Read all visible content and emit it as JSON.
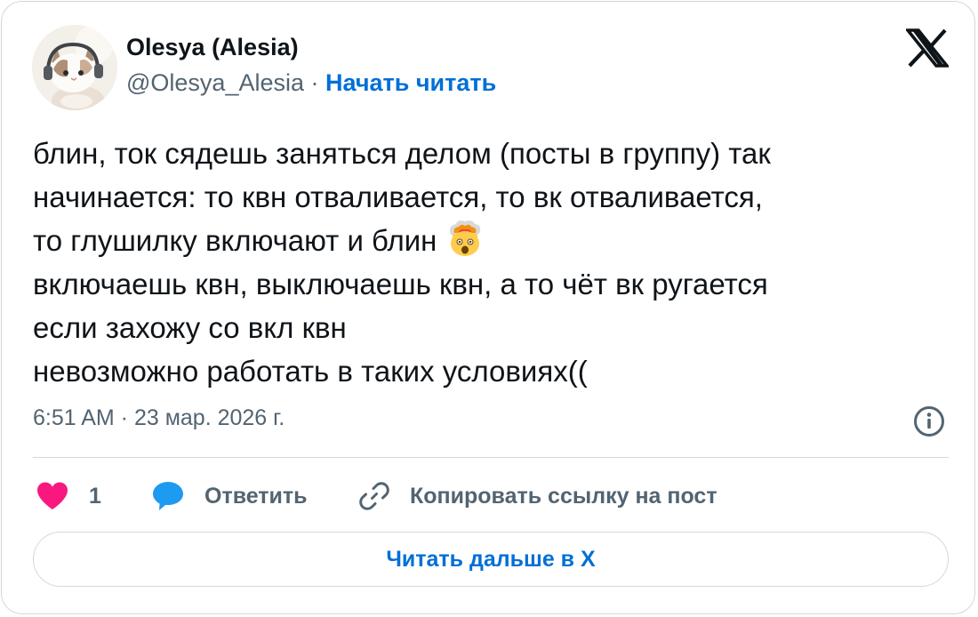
{
  "author": {
    "name": "Olesya (Alesia)",
    "handle": "@Olesya_Alesia",
    "separator": " · ",
    "follow_label": "Начать читать",
    "avatar_icon": "cat-with-headphones-avatar"
  },
  "tweet": {
    "text": "блин, ток сядешь заняться делом (посты в группу) так\nначинается: то квн отваливается, то вк отваливается,\nто глушилку включают и блин ",
    "emoji": "exploding-head-emoji",
    "text_after": "\nвключаешь квн, выключаешь квн, а то чёт вк ругается\nесли захожу со вкл квн\nневозможно работать в таких условиях((",
    "timestamp": "6:51 AM · 23 мар. 2026 г."
  },
  "actions": {
    "like_count": "1",
    "reply_label": "Ответить",
    "copy_label": "Копировать ссылку на пост",
    "like_icon": "heart-icon",
    "reply_icon": "speech-bubble-icon",
    "copy_icon": "link-icon"
  },
  "footer": {
    "read_more_label": "Читать дальше в X"
  },
  "colors": {
    "link_blue": "#006fd6",
    "like_pink": "#f91880",
    "reply_blue": "#1d9bf0",
    "secondary_text": "#536471",
    "border": "#cfd9de"
  }
}
